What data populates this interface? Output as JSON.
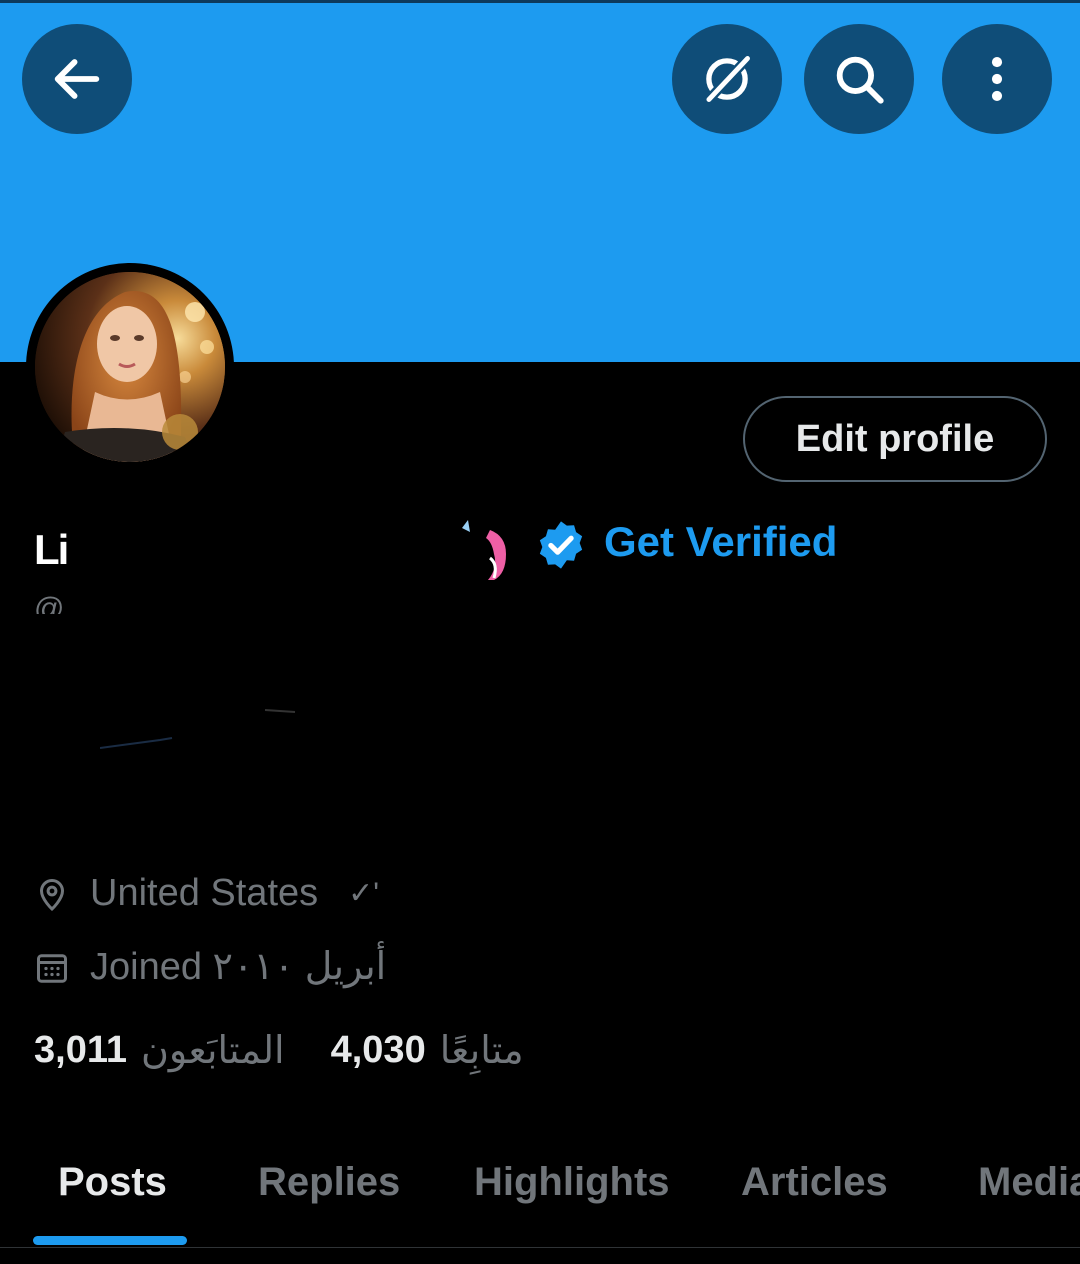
{
  "header": {
    "back_icon": "arrow-left-icon",
    "translate_icon": "grok-slash-icon",
    "search_icon": "search-icon",
    "more_icon": "more-vertical-icon",
    "banner_color": "#1d9bf0",
    "button_color": "#0f4d78"
  },
  "profile": {
    "display_name": "Li",
    "verified_badge_icon": "verified-check-icon",
    "get_verified_label": "Get Verified",
    "handle": "@",
    "edit_profile_label": "Edit profile",
    "accent_color": "#1d9bf0"
  },
  "meta": {
    "location_icon": "location-pin-icon",
    "location": "United States",
    "location_extra": "✓'",
    "calendar_icon": "calendar-icon",
    "joined": "Joined أبريل ٢٠١٠"
  },
  "stats": {
    "followers_count": "3,011",
    "followers_label": "المتابَعون",
    "following_count": "4,030",
    "following_label": "متابِعًا"
  },
  "tabs": [
    {
      "label": "Posts",
      "active": true
    },
    {
      "label": "Replies",
      "active": false
    },
    {
      "label": "Highlights",
      "active": false
    },
    {
      "label": "Articles",
      "active": false
    },
    {
      "label": "Media",
      "active": false
    }
  ]
}
